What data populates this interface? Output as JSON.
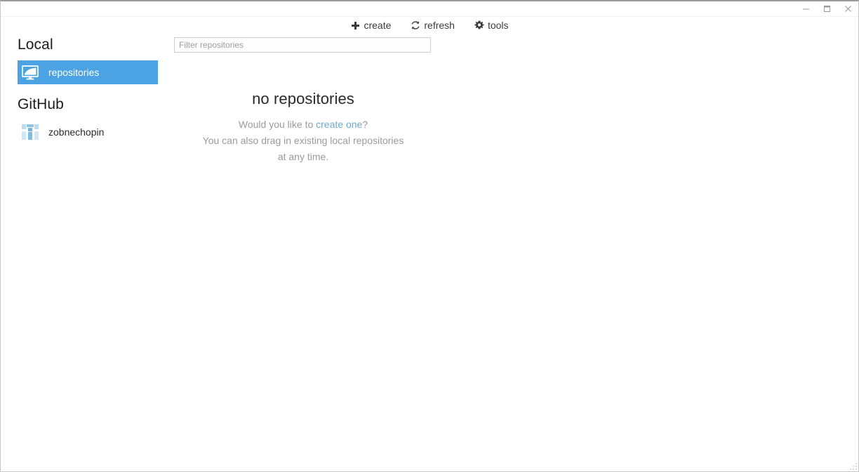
{
  "window": {
    "title": "",
    "controls": {
      "minimize_label": "Minimize",
      "maximize_label": "Maximize",
      "close_label": "Close"
    },
    "accent_color": "#4ba3e3",
    "link_color": "#6fa8c8",
    "border_color": "#c8c8c8"
  },
  "toolbar": {
    "items": [
      {
        "label": "create",
        "icon": "plus-icon"
      },
      {
        "label": "refresh",
        "icon": "refresh-icon"
      },
      {
        "label": "tools",
        "icon": "gear-icon"
      }
    ]
  },
  "sidebar": {
    "sections": [
      {
        "heading": "Local",
        "items": [
          {
            "label": "repositories",
            "icon": "monitor-icon",
            "selected": true
          }
        ]
      },
      {
        "heading": "GitHub",
        "items": [
          {
            "label": "zobnechopin",
            "icon": "avatar-identicon",
            "selected": false
          }
        ]
      }
    ]
  },
  "main": {
    "filter": {
      "value": "",
      "placeholder": "Filter repositories"
    },
    "empty_state": {
      "title": "no repositories",
      "line1_prefix": "Would you like to ",
      "line1_link": "create one",
      "line1_suffix": "?",
      "line2": "You can also drag in existing local repositories",
      "line3": "at any time."
    }
  }
}
